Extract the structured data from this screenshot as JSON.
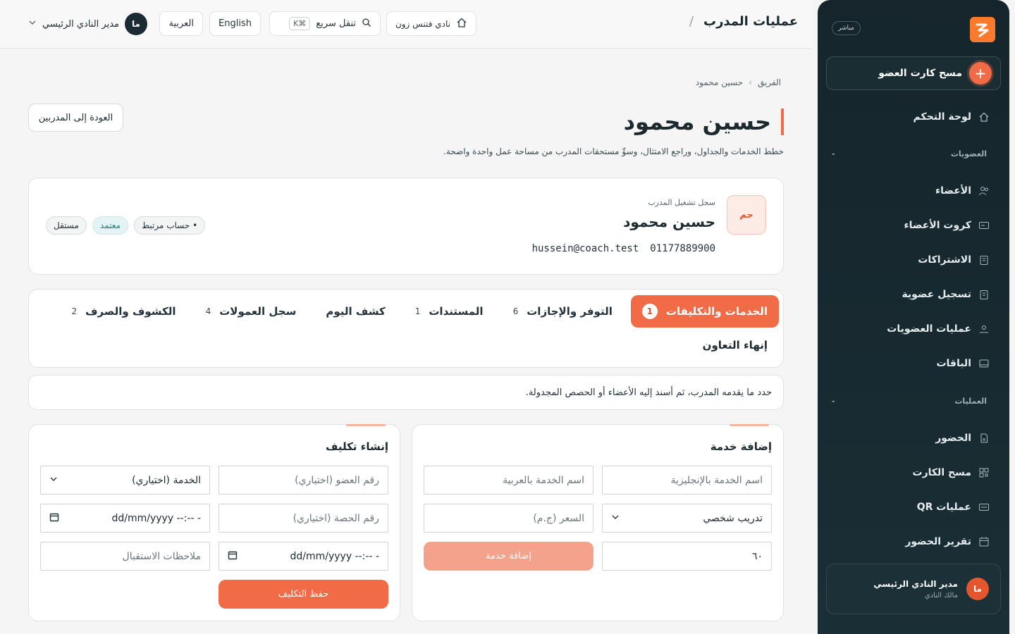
{
  "sidebar": {
    "live_badge": "مباشر",
    "scan_label": "مسح كارت العضو",
    "dashboard": "لوحة التحكم",
    "section_memberships": "العضويات",
    "section_operations": "العمليات",
    "items_members": [
      {
        "label": "الأعضاء"
      },
      {
        "label": "كروت الأعضاء"
      },
      {
        "label": "الاشتراكات"
      },
      {
        "label": "تسجيل عضوية"
      },
      {
        "label": "عمليات العضويات"
      },
      {
        "label": "الباقات"
      }
    ],
    "items_ops": [
      {
        "label": "الحضور"
      },
      {
        "label": "مسح الكارت"
      },
      {
        "label": "عمليات QR"
      },
      {
        "label": "تقرير الحضور"
      }
    ],
    "user": {
      "initials": "ما",
      "name": "مدير النادي الرئيسي",
      "role": "مالك النادي"
    },
    "collapse_glyph": "-"
  },
  "topbar": {
    "title": "عمليات المدرب",
    "slash": "/",
    "club": "نادي فتنس زون",
    "search_label": "تنقل سريع",
    "search_kbd": "⌘K",
    "lang_en": "English",
    "lang_ar": "العربية",
    "admin_initials": "ما",
    "admin_name": "مدير النادي الرئيسي"
  },
  "page": {
    "breadcrumb_root": "الفريق",
    "breadcrumb_sep": "›",
    "breadcrumb_current": "حسين محمود",
    "back_label": "العودة إلى المدربين",
    "title": "حسين محمود",
    "subtitle": "خطط الخدمات والجداول، وراجع الامتثال، وسوِّ مستحقات المدرب من مساحة عمل واحدة واضحة."
  },
  "coach": {
    "initials": "حم",
    "kicker": "سجل تشغيل المدرب",
    "name": "حسين محمود",
    "phone": "01177889900",
    "email": "hussein@coach.test",
    "badges": [
      "مستقل",
      "معتمد",
      "حساب مرتبط"
    ]
  },
  "tabs": [
    {
      "label": "الخدمات والتكليفات",
      "count": "1"
    },
    {
      "label": "التوفر والإجازات",
      "count": "6"
    },
    {
      "label": "المستندات",
      "count": "1"
    },
    {
      "label": "كشف اليوم",
      "count": ""
    },
    {
      "label": "سجل العمولات",
      "count": "4"
    },
    {
      "label": "الكشوف والصرف",
      "count": "2"
    }
  ],
  "tab_end": "إنهاء التعاون",
  "hint": "حدد ما يقدمه المدرب، ثم أسند إليه الأعضاء أو الحصص المجدولة.",
  "add_service": {
    "title": "إضافة خدمة",
    "name_en_placeholder": "اسم الخدمة بالإنجليزية",
    "name_ar_placeholder": "اسم الخدمة بالعربية",
    "type_value": "تدريب شخصي",
    "price_placeholder": "السعر (ج.م)",
    "duration_value": "٦٠",
    "submit": "إضافة خدمة"
  },
  "assignment": {
    "title": "إنشاء تكليف",
    "member_placeholder": "رقم العضو (اختياري)",
    "service_placeholder": "الخدمة (اختياري)",
    "session_placeholder": "رقم الحصة (اختياري)",
    "datetime_placeholder": "dd/mm/yyyy --:-- -",
    "notes_placeholder": "ملاحظات الاستقبال",
    "submit": "حفظ التكليف"
  }
}
